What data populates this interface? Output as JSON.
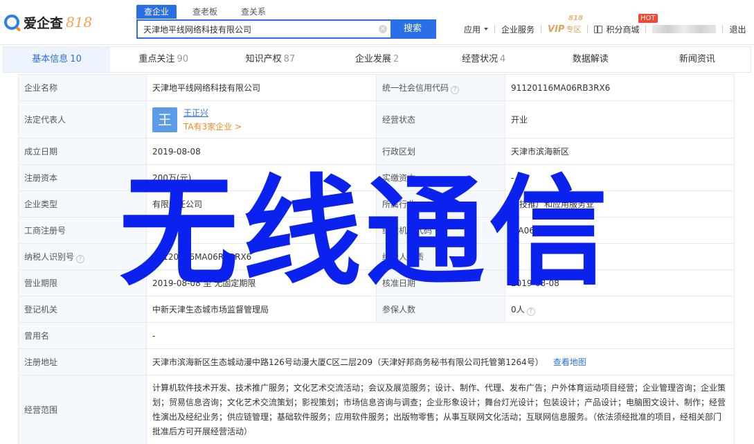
{
  "header": {
    "logo_text": "爱企查",
    "logo_suffix": "818",
    "search_tabs": [
      "查企业",
      "查老板",
      "查关系"
    ],
    "search_value": "天津地平线网络科技有限公司",
    "search_button": "搜索",
    "nav": {
      "app": "应用",
      "enterprise_service": "企业服务",
      "vip": "VIP",
      "vip_suffix": "专区",
      "vip_badge": "818",
      "points_mall": "积分商城",
      "hot": "HOT",
      "logout": "退出"
    }
  },
  "subtabs": [
    {
      "label": "基本信息",
      "count": "10"
    },
    {
      "label": "重点关注",
      "count": "90"
    },
    {
      "label": "知识产权",
      "count": "87"
    },
    {
      "label": "企业发展",
      "count": "2"
    },
    {
      "label": "经营状况",
      "count": "4"
    },
    {
      "label": "数据解读",
      "count": ""
    },
    {
      "label": "新闻资讯",
      "count": ""
    }
  ],
  "info": {
    "company_name_label": "企业名称",
    "company_name": "天津地平线网络科技有限公司",
    "credit_code_label": "统一社会信用代码",
    "credit_code": "91120116MA06RB3RX6",
    "legal_rep_label": "法定代表人",
    "legal_avatar": "王",
    "legal_name": "王正兴",
    "legal_sub": "TA有3家企业 >",
    "status_label": "经营状态",
    "status": "开业",
    "found_date_label": "成立日期",
    "found_date": "2019-08-08",
    "region_label": "行政区划",
    "region": "天津市滨海新区",
    "reg_capital_label": "注册资本",
    "reg_capital": "200万(元)",
    "paid_capital_label": "实缴资本",
    "paid_capital": "-",
    "company_type_label": "企业类型",
    "company_type": "有限责任公司",
    "industry_label": "所属行业",
    "industry": "科技推广和应用服务业",
    "reg_no_label": "工商注册号",
    "reg_no": "",
    "org_code_label": "组织机构代码",
    "org_code": "MA06RB3R-X",
    "tax_id_label": "纳税人识别号",
    "tax_id": "91120116MA06RB3RX6",
    "taxpayer_label": "纳税人资质",
    "taxpayer": "-",
    "term_label": "营业期限",
    "term": "2019-08-08 至 无固定期限",
    "approve_date_label": "核准日期",
    "approve_date": "2019-08-08",
    "authority_label": "登记机关",
    "authority": "中新天津生态城市场监督管理局",
    "insured_label": "参保人数",
    "insured": "0人",
    "former_name_label": "曾用名",
    "former_name": "-",
    "address_label": "注册地址",
    "address": "天津市滨海新区生态城动漫中路126号动漫大厦C区二层209（天津好邦商务秘书有限公司托管第1264号）",
    "map_link": "查看地图",
    "scope_label": "经营范围",
    "scope": "计算机软件技术开发、技术推广服务；文化艺术交流活动；会议及展览服务；设计、制作、代理、发布广告；户外体育运动项目经营；企业管理咨询；企业策划；贸易信息咨询；文化艺术交流策划；影视策划；市场信息咨询与调查；企业形象设计；舞台灯光设计；包装设计；产品设计；电脑图文设计、制作；经营性演出及经纪业务；供应链管理；基础软件服务；应用软件服务；出版物零售；从事互联网文化活动；互联网信息服务。（依法须经批准的项目，经相关部门批准后方可开展经营活动）"
  },
  "watermark": "无线通信",
  "colors": {
    "brand_blue": "#2a6fe6",
    "watermark_blue": "#0b22ee",
    "accent_orange": "#f08a24",
    "hot_red": "#f0492f"
  }
}
